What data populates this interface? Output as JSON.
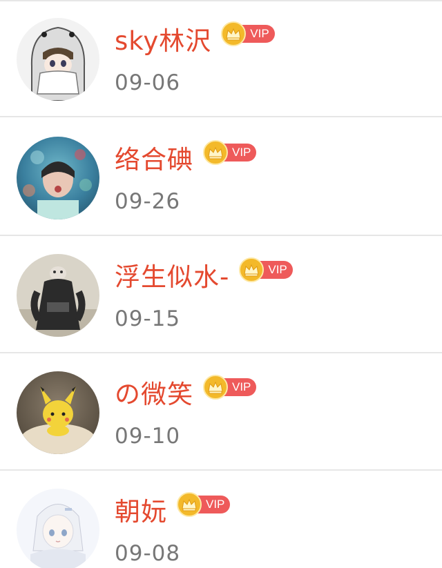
{
  "list": {
    "items": [
      {
        "name": "络合碘",
        "date": "09-26",
        "badge": "VIP",
        "badge_icon": "crown-icon"
      },
      {
        "name": "浮生似水-",
        "date": "09-15",
        "badge": "VIP",
        "badge_icon": "crown-icon"
      },
      {
        "name": "の微笑",
        "date": "09-10",
        "badge": "VIP",
        "badge_icon": "crown-icon"
      },
      {
        "name": "朝妧",
        "date": "09-08",
        "badge": "VIP",
        "badge_icon": "crown-icon"
      },
      {
        "name": "sky林沢",
        "date": "09-06",
        "badge": "VIP",
        "badge_icon": "crown-icon"
      }
    ]
  },
  "colors": {
    "name": "#e4492f",
    "date": "#777777",
    "vip_pill": "#ee5a5a",
    "crown": "#f3b92a",
    "divider": "#e6e6e6"
  }
}
